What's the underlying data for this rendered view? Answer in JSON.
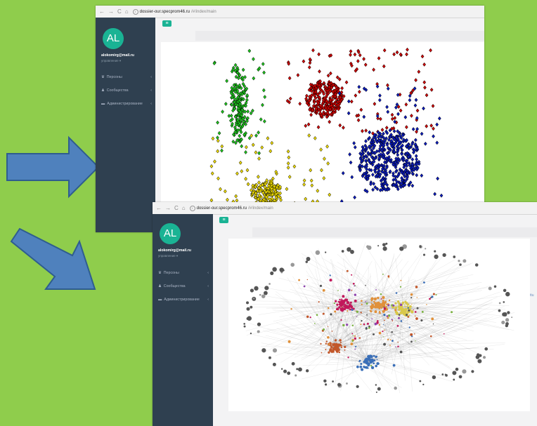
{
  "colors": {
    "background": "#8fcd4c",
    "arrow_fill": "#4f81bd",
    "arrow_stroke": "#2f5d8f",
    "sidebar": "#2f4050",
    "accent": "#1ab394"
  },
  "windows": [
    {
      "address": {
        "host": "dossier-our.specprom46.ru",
        "path": "/#/index/main"
      },
      "avatar": "AL",
      "email": "alokomirg@mail.ru",
      "role": "управление ▾",
      "menu": [
        {
          "label": "Персоны",
          "icon": "users-icon"
        },
        {
          "label": "Сообщества",
          "icon": "user-group-icon"
        },
        {
          "label": "Администрирование",
          "icon": "id-card-icon"
        }
      ],
      "menu_button_icon": "hamburger-icon",
      "graph": "clustered scatter of communities"
    },
    {
      "address": {
        "host": "dossier-our.specprom46.ru",
        "path": "/#/index/main"
      },
      "avatar": "AL",
      "email": "alokomirg@mail.ru",
      "role": "управление ▾",
      "menu": [
        {
          "label": "Персоны",
          "icon": "users-icon"
        },
        {
          "label": "Сообщества",
          "icon": "user-group-icon"
        },
        {
          "label": "Администрирование",
          "icon": "id-card-icon"
        }
      ],
      "menu_button_icon": "hamburger-icon",
      "graph": "network graph with colored clusters",
      "edge_text": "ttu"
    }
  ],
  "arrows": [
    {
      "direction": "right"
    },
    {
      "direction": "down-right"
    }
  ]
}
